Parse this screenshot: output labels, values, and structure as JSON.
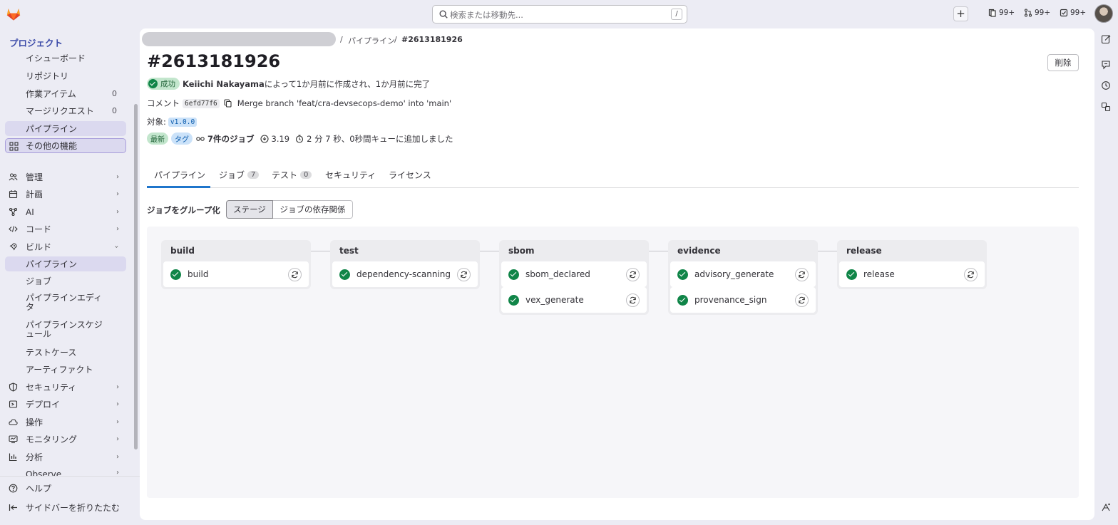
{
  "topbar": {
    "search_placeholder": "検索または移動先...",
    "search_shortcut": "/",
    "counters": [
      {
        "icon": "issues-icon",
        "label": "99+"
      },
      {
        "icon": "merge-request-icon",
        "label": "99+"
      },
      {
        "icon": "todo-icon",
        "label": "99+"
      }
    ]
  },
  "sidebar": {
    "header": "プロジェクト",
    "items": [
      {
        "label": "イシューボード"
      },
      {
        "label": "リポジトリ"
      },
      {
        "label": "作業アイテム",
        "count": "0"
      },
      {
        "label": "マージリクエスト",
        "count": "0"
      },
      {
        "label": "パイプライン"
      },
      {
        "label": "その他の機能"
      }
    ],
    "groups": [
      {
        "label": "管理"
      },
      {
        "label": "計画"
      },
      {
        "label": "AI"
      },
      {
        "label": "コード"
      },
      {
        "label": "ビルド"
      }
    ],
    "build_items": [
      {
        "label": "パイプライン"
      },
      {
        "label": "ジョブ"
      },
      {
        "label": "パイプラインエディタ"
      },
      {
        "label": "パイプラインスケジュール"
      },
      {
        "label": "テストケース"
      },
      {
        "label": "アーティファクト"
      }
    ],
    "groups2": [
      {
        "label": "セキュリティ"
      },
      {
        "label": "デプロイ"
      },
      {
        "label": "操作"
      },
      {
        "label": "モニタリング"
      },
      {
        "label": "分析"
      },
      {
        "label": "Observe"
      }
    ],
    "help": "ヘルプ",
    "collapse": "サイドバーを折りたたむ"
  },
  "breadcrumb": {
    "sep1": "/",
    "item1": "パイプライン",
    "sep2": "/",
    "current": "#2613181926"
  },
  "pipeline": {
    "title": "#2613181926",
    "delete_label": "削除",
    "status": "成功",
    "author": "Keiichi Nakayama",
    "status_text": "によって1か月前に作成され、1か月前に完了",
    "comment_label": "コメント",
    "commit_sha": "6efd77f6",
    "commit_message": "Merge branch 'feat/cra-devsecops-demo' into 'main'",
    "target_label": "対象:",
    "target_tag": "v1.0.0",
    "badge_latest": "最新",
    "badge_tag": "タグ",
    "jobs_count_text": "7件のジョブ",
    "coverage": "3.19",
    "duration_text": "2 分 7 秒、0秒間キューに追加しました"
  },
  "tabs": [
    {
      "label": "パイプライン"
    },
    {
      "label": "ジョブ",
      "count": "7"
    },
    {
      "label": "テスト",
      "count": "0"
    },
    {
      "label": "セキュリティ"
    },
    {
      "label": "ライセンス"
    }
  ],
  "group_by": {
    "label": "ジョブをグループ化",
    "options": [
      "ステージ",
      "ジョブの依存関係"
    ]
  },
  "stages": [
    {
      "name": "build",
      "jobs": [
        "build"
      ]
    },
    {
      "name": "test",
      "jobs": [
        "dependency-scanning"
      ]
    },
    {
      "name": "sbom",
      "jobs": [
        "sbom_declared",
        "vex_generate"
      ]
    },
    {
      "name": "evidence",
      "jobs": [
        "advisory_generate",
        "provenance_sign"
      ]
    },
    {
      "name": "release",
      "jobs": [
        "release"
      ]
    }
  ],
  "colors": {
    "success": "#108548",
    "accent": "#1f75cb",
    "sidebar_active": "#dbd9ef"
  }
}
